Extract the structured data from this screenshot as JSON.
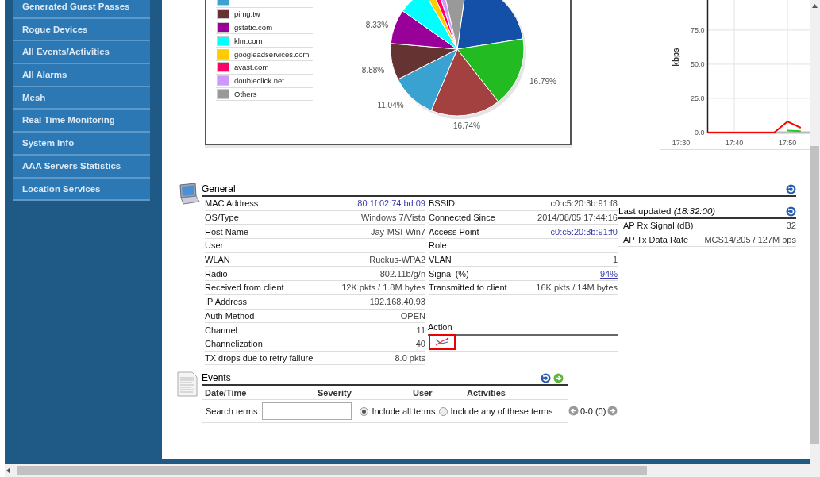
{
  "sidebar": {
    "items": [
      {
        "label": "Generated Guest Passes"
      },
      {
        "label": "Rogue Devices"
      },
      {
        "label": "All Events/Activities"
      },
      {
        "label": "All Alarms"
      },
      {
        "label": "Mesh"
      },
      {
        "label": "Real Time Monitoring"
      },
      {
        "label": "System Info"
      },
      {
        "label": "AAA Servers Statistics"
      },
      {
        "label": "Location Services"
      }
    ]
  },
  "top_sites_chart": {
    "legend": [
      {
        "color": "#3aa2d0"
      },
      {
        "label": "pimg.tw",
        "color": "#663333"
      },
      {
        "label": "gstatic.com",
        "color": "#990099"
      },
      {
        "label": "klm.com",
        "color": "#00ffff"
      },
      {
        "label": "googleadservices.com",
        "color": "#ffcc00"
      },
      {
        "label": "avast.com",
        "color": "#ff0066"
      },
      {
        "label": "doubleclick.net",
        "color": "#cc99ff"
      },
      {
        "label": "Others",
        "color": "#999999"
      }
    ],
    "slice_labels": [
      "8.33%",
      "8.88%",
      "11.04%",
      "16.74%",
      "16.79%"
    ]
  },
  "throughput_chart": {
    "chart_data": {
      "type": "line",
      "ylabel": "kbps",
      "categories": [
        "17:30",
        null,
        null,
        null,
        "17:40",
        null,
        null,
        null,
        "17:50",
        null
      ],
      "series": [
        {
          "color": "#ff0000",
          "values": [
            null,
            null,
            0,
            0,
            0,
            0,
            0,
            0,
            8,
            3.5
          ]
        },
        {
          "color": "#22cc22",
          "values": [
            null,
            null,
            null,
            null,
            null,
            null,
            null,
            null,
            1.5,
            1
          ]
        }
      ],
      "ylim": [
        0,
        97
      ],
      "grid": true,
      "yticks": [
        {
          "value": 0,
          "label": "0.0"
        },
        {
          "value": 25,
          "label": "25.0"
        },
        {
          "value": 50,
          "label": "50.0"
        },
        {
          "value": 75,
          "label": "75.0"
        }
      ]
    }
  },
  "general": {
    "title": "General",
    "client_rows": [
      {
        "label": "MAC Address",
        "value": "80:1f:02:74:bd:09",
        "kind": "address"
      },
      {
        "label": "OS/Type",
        "value": "Windows 7/Vista",
        "kind": "plain"
      },
      {
        "label": "Host Name",
        "value": "Jay-MSI-Win7",
        "kind": "plain"
      },
      {
        "label": "User"
      },
      {
        "label": "WLAN",
        "value": "Ruckus-WPA2",
        "kind": "plain"
      },
      {
        "label": "Radio",
        "value": "802.11b/g/n",
        "kind": "plain"
      },
      {
        "label": "Received from client",
        "value": "12K pkts / 1.8M bytes",
        "kind": "plain"
      },
      {
        "label": "IP Address",
        "value": "192.168.40.93",
        "kind": "plain"
      },
      {
        "label": "Auth Method",
        "value": "OPEN",
        "kind": "plain"
      },
      {
        "label": "Channel",
        "value": "11",
        "kind": "plain"
      },
      {
        "label": "Channelization",
        "value": "40",
        "kind": "plain"
      },
      {
        "label": "TX drops due to retry failure",
        "value": "8.0 pkts",
        "kind": "plain"
      }
    ],
    "connection_rows": [
      {
        "label": "BSSID",
        "value": "c0:c5:20:3b:91:f8",
        "kind": "plain"
      },
      {
        "label": "Connected Since",
        "value": "2014/08/05  17:44:16",
        "kind": "plain"
      },
      {
        "label": "Access Point",
        "value": "c0:c5:20:3b:91:f0",
        "kind": "address"
      },
      {
        "label": "Role"
      },
      {
        "label": "VLAN",
        "value": "1",
        "kind": "plain"
      },
      {
        "label": "Signal (%)",
        "value": "94%",
        "kind": "link"
      },
      {
        "label": "Transmitted to client",
        "value": "16K pkts / 14M bytes",
        "kind": "plain"
      }
    ],
    "action": {
      "title": "Action"
    },
    "ap_panel": {
      "title": "Last updated *(18:32:00)*",
      "rows": [
        {
          "label": "AP Rx Signal (dB)",
          "value": "32",
          "kind": "plain"
        },
        {
          "label": "AP Tx Data Rate",
          "value": "MCS14/205 / 127M bps",
          "kind": "plain"
        }
      ]
    }
  },
  "events": {
    "title": "Events",
    "columns": [
      "Date/Time",
      "Severity",
      "User",
      "Activities"
    ],
    "search": {
      "label": "Search terms",
      "options": [
        {
          "label": "Include all terms",
          "selected": true
        },
        {
          "label": "Include any of these terms",
          "selected": false
        }
      ]
    },
    "pager": "0-0 (0)"
  }
}
